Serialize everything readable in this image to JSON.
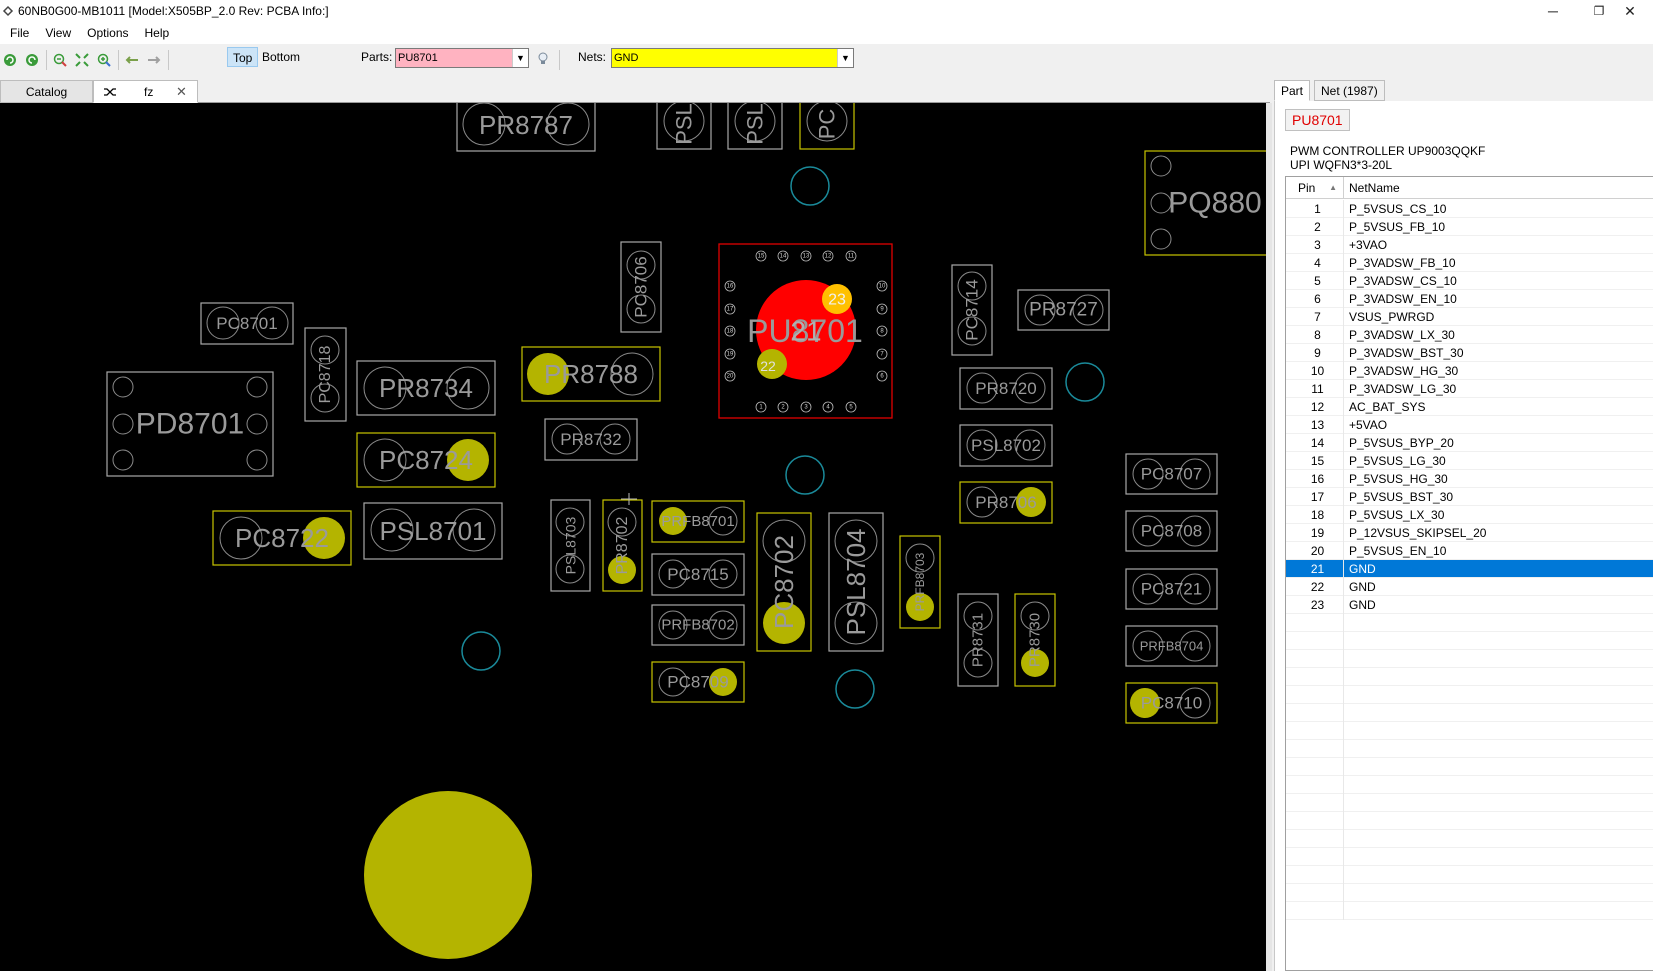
{
  "window": {
    "title": "60NB0G00-MB1011 [Model:X505BP_2.0 Rev: PCBA Info:]",
    "minimize": "─",
    "restore": "❐",
    "close": "✕"
  },
  "menu": [
    "File",
    "View",
    "Options",
    "Help"
  ],
  "toolbar": {
    "side_top": "Top",
    "side_bottom": "Bottom",
    "parts_label": "Parts:",
    "parts_value": "PU8701",
    "nets_label": "Nets:",
    "nets_value": "GND"
  },
  "doc_tabs": {
    "catalog": "Catalog",
    "fz": "fz",
    "close": "✕"
  },
  "colors": {
    "board_bg": "#000000",
    "outline": "#a8a8a8",
    "highlight": "#c8c400",
    "gnd_pad": "#b4b400",
    "selected_pad": "#ff0000",
    "selected_outline": "#e00000",
    "via": "#1a8a9a",
    "accent_selection": "#0078d7"
  },
  "board": {
    "components": [
      {
        "name": "PR8787",
        "hl": false
      },
      {
        "name": "PSL",
        "hl": false
      },
      {
        "name": "PSL",
        "hl": false
      },
      {
        "name": "PC",
        "hl": true
      },
      {
        "name": "PQ880",
        "hl": true
      },
      {
        "name": "PC8706",
        "hl": false
      },
      {
        "name": "PU8701",
        "hl": false,
        "selected": true
      },
      {
        "name": "PC8714",
        "hl": false
      },
      {
        "name": "PR8727",
        "hl": false
      },
      {
        "name": "PC8701",
        "hl": false
      },
      {
        "name": "PC8718",
        "hl": false
      },
      {
        "name": "PR8734",
        "hl": false
      },
      {
        "name": "PR8788",
        "hl": true
      },
      {
        "name": "PD8701",
        "hl": false
      },
      {
        "name": "PR8720",
        "hl": false
      },
      {
        "name": "PR8732",
        "hl": false
      },
      {
        "name": "PC8724",
        "hl": true
      },
      {
        "name": "PSL8702",
        "hl": false
      },
      {
        "name": "PR8706",
        "hl": true
      },
      {
        "name": "PC8707",
        "hl": false
      },
      {
        "name": "PC8722",
        "hl": true
      },
      {
        "name": "PSL8701",
        "hl": false
      },
      {
        "name": "PSL8703",
        "hl": false
      },
      {
        "name": "PR8702",
        "hl": true
      },
      {
        "name": "PRFB8701",
        "hl": true
      },
      {
        "name": "PC8702",
        "hl": true
      },
      {
        "name": "PSL8704",
        "hl": false
      },
      {
        "name": "PRFB8703",
        "hl": true
      },
      {
        "name": "PC8708",
        "hl": false
      },
      {
        "name": "PC8715",
        "hl": false
      },
      {
        "name": "PC8721",
        "hl": false
      },
      {
        "name": "PRFB8702",
        "hl": false
      },
      {
        "name": "PR8731",
        "hl": false
      },
      {
        "name": "PR8730",
        "hl": true
      },
      {
        "name": "PRFB8704",
        "hl": false
      },
      {
        "name": "PC8709",
        "hl": true
      },
      {
        "name": "PC8710",
        "hl": true
      }
    ],
    "pu_pin_labels": {
      "top": [
        "15",
        "14",
        "13",
        "12",
        "11"
      ],
      "left": [
        "16",
        "17",
        "18",
        "19",
        "20"
      ],
      "right": [
        "10",
        "9",
        "8",
        "7",
        "6"
      ],
      "bottom": [
        "1",
        "2",
        "3",
        "4",
        "5"
      ],
      "center_pin": "21",
      "pin_23": "23",
      "pin_22": "22"
    }
  },
  "panel": {
    "tab_part": "Part",
    "tab_net": "Net (1987)",
    "part_name": "PU8701",
    "desc_line1": "PWM CONTROLLER UP9003QQKF",
    "desc_line2": "UPI WQFN3*3-20L",
    "col_pin": "Pin",
    "col_net": "NetName",
    "sort_indicator": "▲",
    "rows": [
      {
        "pin": "1",
        "net": "P_5VSUS_CS_10"
      },
      {
        "pin": "2",
        "net": "P_5VSUS_FB_10"
      },
      {
        "pin": "3",
        "net": "+3VAO"
      },
      {
        "pin": "4",
        "net": "P_3VADSW_FB_10"
      },
      {
        "pin": "5",
        "net": "P_3VADSW_CS_10"
      },
      {
        "pin": "6",
        "net": "P_3VADSW_EN_10"
      },
      {
        "pin": "7",
        "net": "VSUS_PWRGD"
      },
      {
        "pin": "8",
        "net": "P_3VADSW_LX_30"
      },
      {
        "pin": "9",
        "net": "P_3VADSW_BST_30"
      },
      {
        "pin": "10",
        "net": "P_3VADSW_HG_30"
      },
      {
        "pin": "11",
        "net": "P_3VADSW_LG_30"
      },
      {
        "pin": "12",
        "net": "AC_BAT_SYS"
      },
      {
        "pin": "13",
        "net": "+5VAO"
      },
      {
        "pin": "14",
        "net": "P_5VSUS_BYP_20"
      },
      {
        "pin": "15",
        "net": "P_5VSUS_LG_30"
      },
      {
        "pin": "16",
        "net": "P_5VSUS_HG_30"
      },
      {
        "pin": "17",
        "net": "P_5VSUS_BST_30"
      },
      {
        "pin": "18",
        "net": "P_5VSUS_LX_30"
      },
      {
        "pin": "19",
        "net": "P_12VSUS_SKIPSEL_20"
      },
      {
        "pin": "20",
        "net": "P_5VSUS_EN_10"
      },
      {
        "pin": "21",
        "net": "GND",
        "selected": true
      },
      {
        "pin": "22",
        "net": "GND"
      },
      {
        "pin": "23",
        "net": "GND"
      }
    ]
  }
}
